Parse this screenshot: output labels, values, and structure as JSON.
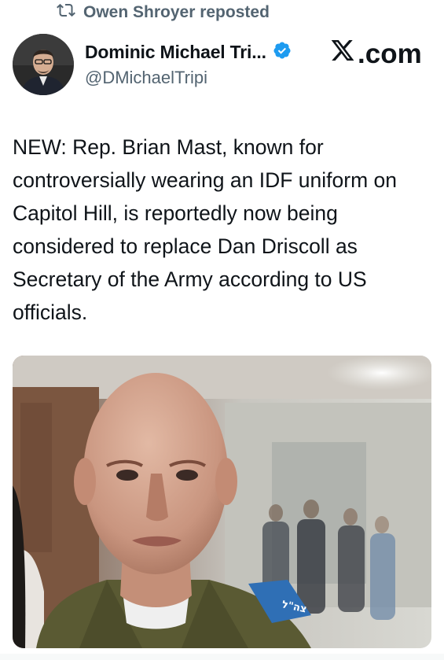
{
  "repost": {
    "icon": "repost-icon",
    "text": "Owen Shroyer reposted"
  },
  "author": {
    "name": "Dominic Michael Tri...",
    "handle": "@DMichaelTripi",
    "verified_icon": "verified-badge-icon",
    "avatar_icon": "avatar"
  },
  "brand": {
    "text": ".com",
    "logo_icon": "x-logo-icon"
  },
  "tweet": {
    "text": "NEW: Rep. Brian Mast, known for controversially wearing an IDF uniform on Capitol Hill, is reportedly now being considered to replace Dan Driscoll as Secretary of the Army according to US officials."
  },
  "media": {
    "icon": "photo",
    "patch_text": "צה\"ל"
  },
  "colors": {
    "text": "#0f1419",
    "secondary": "#536471",
    "verified": "#1d9bf0",
    "uniform": "#5a5a33",
    "patch": "#2f6fb5"
  }
}
